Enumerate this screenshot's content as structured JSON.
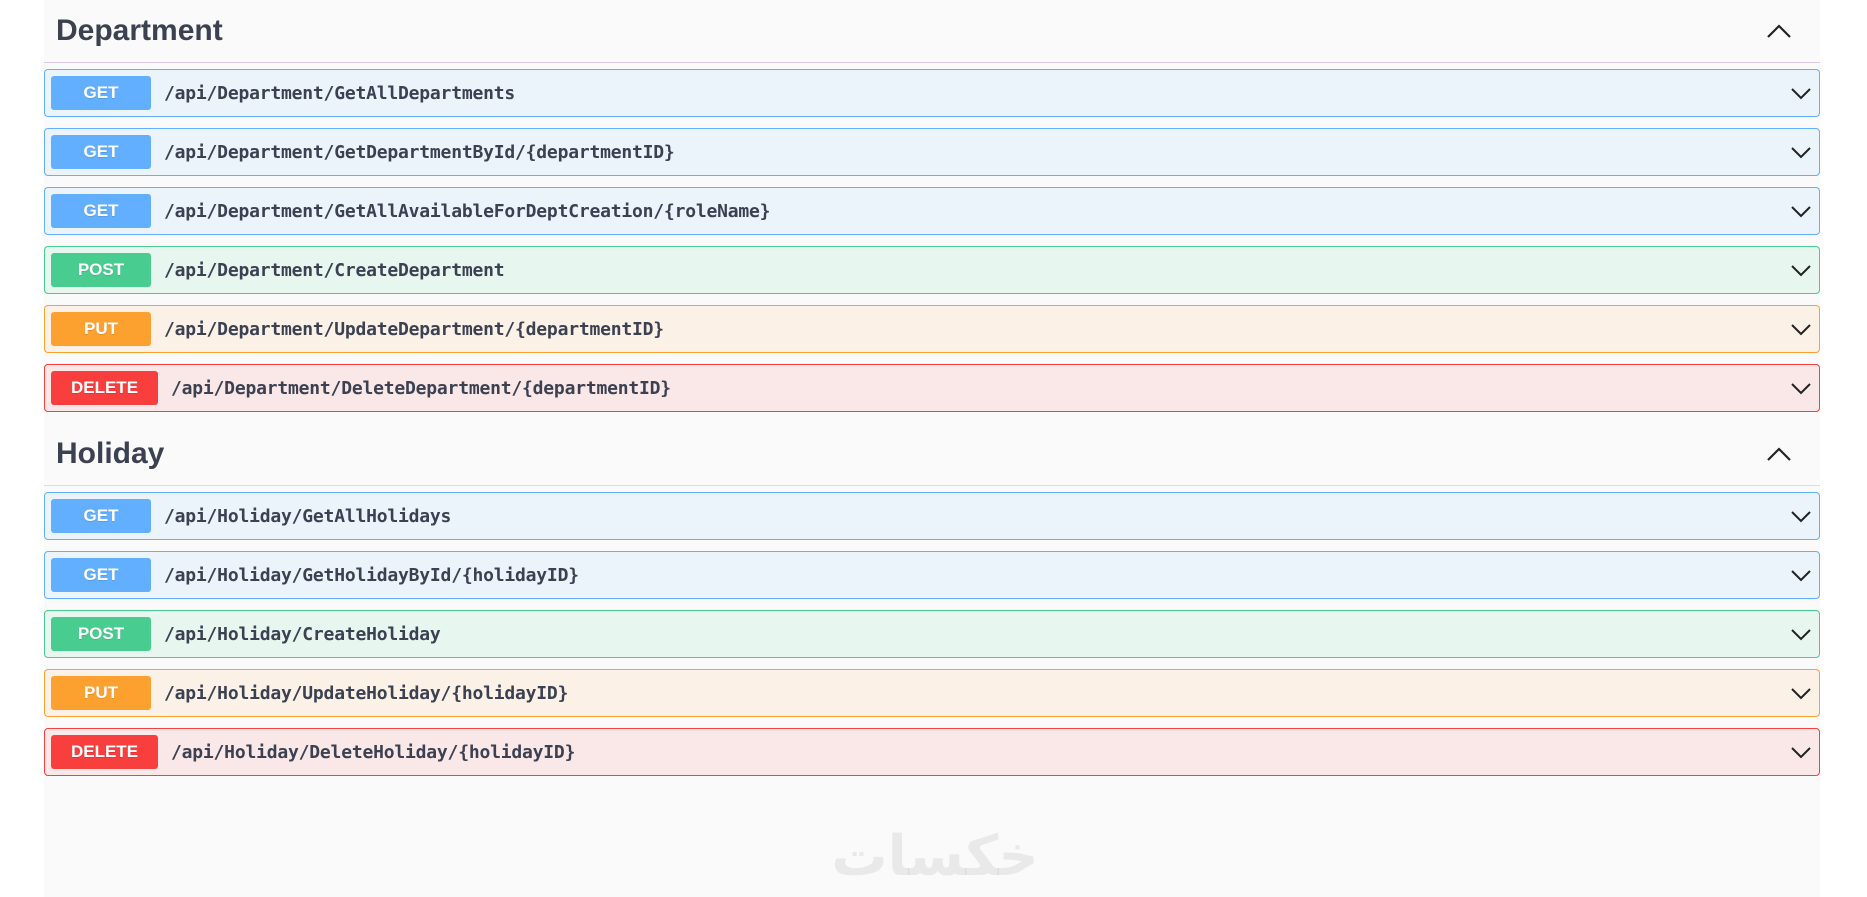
{
  "sections": [
    {
      "title": "Department",
      "operations": [
        {
          "method": "GET",
          "path": "/api/Department/GetAllDepartments"
        },
        {
          "method": "GET",
          "path": "/api/Department/GetDepartmentById/{departmentID}"
        },
        {
          "method": "GET",
          "path": "/api/Department/GetAllAvailableForDeptCreation/{roleName}"
        },
        {
          "method": "POST",
          "path": "/api/Department/CreateDepartment"
        },
        {
          "method": "PUT",
          "path": "/api/Department/UpdateDepartment/{departmentID}"
        },
        {
          "method": "DELETE",
          "path": "/api/Department/DeleteDepartment/{departmentID}"
        }
      ]
    },
    {
      "title": "Holiday",
      "operations": [
        {
          "method": "GET",
          "path": "/api/Holiday/GetAllHolidays"
        },
        {
          "method": "GET",
          "path": "/api/Holiday/GetHolidayById/{holidayID}"
        },
        {
          "method": "POST",
          "path": "/api/Holiday/CreateHoliday"
        },
        {
          "method": "PUT",
          "path": "/api/Holiday/UpdateHoliday/{holidayID}"
        },
        {
          "method": "DELETE",
          "path": "/api/Holiday/DeleteHoliday/{holidayID}"
        }
      ]
    }
  ],
  "watermark": "خکسات",
  "colors": {
    "get": "#61affe",
    "post": "#49cc90",
    "put": "#fca130",
    "delete": "#f93e3e",
    "text": "#3b4151"
  },
  "icons": {
    "section_toggle": "chevron-up-icon",
    "operation_toggle": "chevron-down-icon"
  }
}
